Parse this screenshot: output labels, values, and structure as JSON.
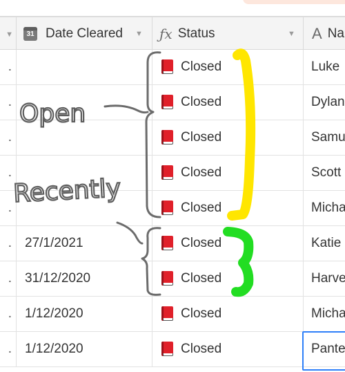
{
  "columns": {
    "date_cleared": "Date Cleared",
    "status": "Status",
    "name": "Na",
    "calendar_icon_text": "31"
  },
  "rows": [
    {
      "date": "",
      "status": "Closed",
      "name": "Luke"
    },
    {
      "date": "",
      "status": "Closed",
      "name": "Dylan"
    },
    {
      "date": "",
      "status": "Closed",
      "name": "Samu"
    },
    {
      "date": "",
      "status": "Closed",
      "name": "Scott"
    },
    {
      "date": "",
      "status": "Closed",
      "name": "Micha"
    },
    {
      "date": "27/1/2021",
      "status": "Closed",
      "name": "Katie"
    },
    {
      "date": "31/12/2020",
      "status": "Closed",
      "name": "Harve"
    },
    {
      "date": "1/12/2020",
      "status": "Closed",
      "name": "Micha"
    },
    {
      "date": "1/12/2020",
      "status": "Closed",
      "name": "Pante"
    }
  ],
  "annotations": {
    "open_label": "Open",
    "recently_label": "Recently",
    "open_highlight_color": "#ffe600",
    "recent_highlight_color": "#22dd22"
  },
  "icons": {
    "date_field": "calendar-icon",
    "status_field": "formula-icon",
    "name_field": "text-field-icon",
    "status_value": "red-book-icon"
  }
}
